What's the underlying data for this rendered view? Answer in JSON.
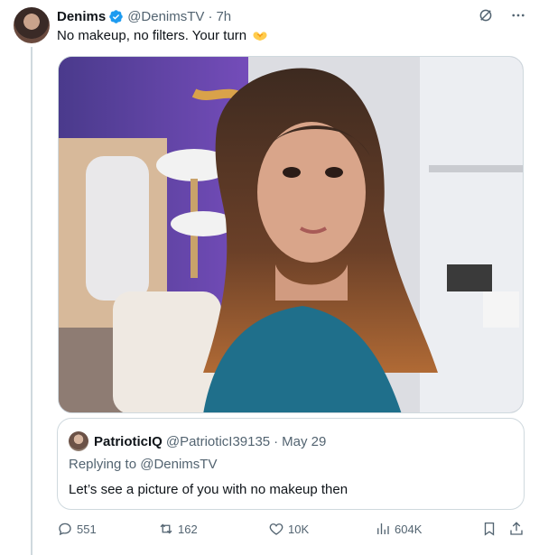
{
  "author": {
    "name": "Denims",
    "handle": "@DenimsTV",
    "separator": "·",
    "time": "7h",
    "verified": true
  },
  "tweet": {
    "text": "No makeup, no filters. Your turn",
    "emoji": "heart-hands-emoji"
  },
  "media": {
    "description_icon": "photo"
  },
  "quoted_tweet": {
    "name": "PatrioticIQ",
    "handle": "@PatrioticI39135",
    "separator": "·",
    "date": "May 29",
    "replying_to": "Replying to @DenimsTV",
    "text": "Let’s see a picture of you with no makeup then"
  },
  "actions": {
    "replies": "551",
    "reposts": "162",
    "likes": "10K",
    "views": "604K"
  },
  "colors": {
    "secondary_text": "#536471",
    "primary_text": "#0f1419",
    "verified": "#1d9bf0",
    "border": "#cfd9de"
  }
}
